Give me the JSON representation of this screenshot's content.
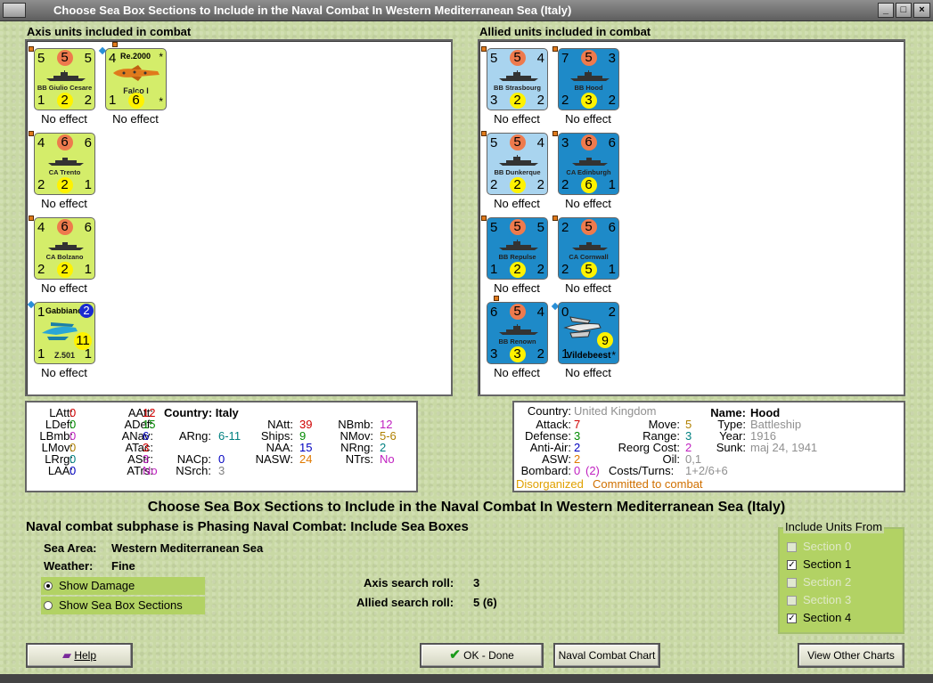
{
  "window": {
    "title": "Choose Sea Box Sections to Include in the Naval Combat In Western Mediterranean Sea (Italy)"
  },
  "axis_panel": {
    "title": "Axis units included in combat"
  },
  "allied_panel": {
    "title": "Allied units included in combat"
  },
  "axis_units": [
    {
      "name": "BB Giulio Cesare",
      "tl": "5",
      "top": "5",
      "tr": "5",
      "bl": "1",
      "bot": "2",
      "br": "2",
      "status": "No effect"
    },
    {
      "name": "Falco I",
      "type": "Re.2000",
      "tl": "4",
      "tr": "*",
      "bl": "1",
      "bot": "6",
      "br": "*",
      "status": "No effect"
    },
    {
      "name": "CA Trento",
      "tl": "4",
      "top": "6",
      "tr": "6",
      "bl": "2",
      "bot": "2",
      "br": "1",
      "status": "No effect"
    },
    {
      "name": "CA Bolzano",
      "tl": "4",
      "top": "6",
      "tr": "6",
      "bl": "2",
      "bot": "2",
      "br": "1",
      "status": "No effect"
    },
    {
      "name": "Z.501",
      "type": "Gabbiano",
      "tl": "1",
      "top": "2",
      "bl": "1",
      "bot": "11",
      "br": "1",
      "status": "No effect"
    }
  ],
  "allied_units": [
    {
      "name": "BB Strasbourg",
      "tl": "5",
      "top": "5",
      "tr": "4",
      "bl": "3",
      "bot": "2",
      "br": "2",
      "status": "No effect"
    },
    {
      "name": "BB Hood",
      "tl": "7",
      "top": "5",
      "tr": "3",
      "bl": "2",
      "bot": "3",
      "br": "2",
      "status": "No effect"
    },
    {
      "name": "BB Dunkerque",
      "tl": "5",
      "top": "5",
      "tr": "4",
      "bl": "2",
      "bot": "2",
      "br": "2",
      "status": "No effect"
    },
    {
      "name": "CA Edinburgh",
      "tl": "3",
      "top": "6",
      "tr": "6",
      "bl": "2",
      "bot": "6",
      "br": "1",
      "status": "No effect"
    },
    {
      "name": "BB Repulse",
      "tl": "5",
      "top": "5",
      "tr": "5",
      "bl": "1",
      "bot": "2",
      "br": "2",
      "status": "No effect"
    },
    {
      "name": "CA Cornwall",
      "tl": "2",
      "top": "5",
      "tr": "6",
      "bl": "2",
      "bot": "5",
      "br": "1",
      "status": "No effect"
    },
    {
      "name": "BB Renown",
      "tl": "6",
      "top": "5",
      "tr": "4",
      "bl": "3",
      "bot": "3",
      "br": "2",
      "status": "No effect"
    },
    {
      "name": "Vildebeest",
      "tl": "0",
      "tr": "2",
      "bl": "1",
      "bot": "9",
      "br": "*",
      "status": "No effect"
    }
  ],
  "axis_stats": {
    "latt_l": "LAtt:",
    "latt": "0",
    "ldef_l": "LDef:",
    "ldef": "0",
    "lbmb_l": "LBmb:",
    "lbmb": "0",
    "lmov_l": "LMov:",
    "lmov": "0",
    "lrrg_l": "LRrg:",
    "lrrg": "0",
    "laa_l": "LAA:",
    "laa": "0",
    "aatt_l": "AAtt:",
    "aatt": "12",
    "adef_l": "ADef:",
    "adef": "15",
    "anav_l": "ANav:",
    "anav": "6",
    "atac_l": "ATac:",
    "atac": "3",
    "astr_l": "AStr:",
    "astr": "3",
    "atrs_l": "ATrs:",
    "atrs": "No",
    "country": "Country: Italy",
    "arng_l": "ARng:",
    "arng": "6-11",
    "nacp_l": "NACp:",
    "nacp": "0",
    "nsrch_l": "NSrch:",
    "nsrch": "3",
    "natt_l": "NAtt:",
    "natt": "39",
    "ships_l": "Ships:",
    "ships": "9",
    "naa_l": "NAA:",
    "naa": "15",
    "nasw_l": "NASW:",
    "nasw": "24",
    "nbmb_l": "NBmb:",
    "nbmb": "12",
    "nmov_l": "NMov:",
    "nmov": "5-6",
    "nrng_l": "NRng:",
    "nrng": "2",
    "ntrs_l": "NTrs:",
    "ntrs": "No"
  },
  "unit_info": {
    "country_l": "Country:",
    "country": "United Kingdom",
    "attack_l": "Attack:",
    "attack": "7",
    "defense_l": "Defense:",
    "defense": "3",
    "antiair_l": "Anti-Air:",
    "antiair": "2",
    "asw_l": "ASW:",
    "asw": "2",
    "bombard_l": "Bombard:",
    "bombard": "0",
    "bombard2": "(2)",
    "move_l": "Move:",
    "move": "5",
    "range_l": "Range:",
    "range": "3",
    "reorg_l": "Reorg Cost:",
    "reorg": "2",
    "oil_l": "Oil:",
    "oil": "0,1",
    "costs_l": "Costs/Turns:",
    "costs": "1+2/6+6",
    "name_l": "Name:",
    "name": "Hood",
    "type_l": "Type:",
    "type": "Battleship",
    "year_l": "Year:",
    "year": "1916",
    "sunk_l": "Sunk:",
    "sunk": "maj 24, 1941",
    "disorganized": "Disorganized",
    "committed": "Committed to combat"
  },
  "main": {
    "heading": "Choose Sea Box Sections to Include in the Naval Combat In Western Mediterranean Sea (Italy)",
    "subphase": "Naval combat subphase is Phasing Naval Combat: Include Sea Boxes",
    "sea_area_l": "Sea Area:",
    "sea_area": "Western Mediterranean Sea",
    "weather_l": "Weather:",
    "weather": "Fine",
    "axis_roll_l": "Axis search roll:",
    "axis_roll": "3",
    "allied_roll_l": "Allied search roll:",
    "allied_roll": "5 (6)"
  },
  "view_options": {
    "show_damage": "Show Damage",
    "show_sections": "Show Sea Box Sections"
  },
  "include_units": {
    "legend": "Include Units From",
    "sections": [
      {
        "label": "Section 0",
        "checked": false,
        "enabled": false
      },
      {
        "label": "Section 1",
        "checked": true,
        "enabled": true
      },
      {
        "label": "Section 2",
        "checked": false,
        "enabled": false
      },
      {
        "label": "Section 3",
        "checked": false,
        "enabled": false
      },
      {
        "label": "Section 4",
        "checked": true,
        "enabled": true
      }
    ]
  },
  "buttons": {
    "help": "Help",
    "ok": "OK - Done",
    "naval_chart": "Naval Combat Chart",
    "other_charts": "View Other Charts"
  },
  "colors": {
    "axis_counter": "#d4ed6a",
    "allied_light": "#a9d4ef",
    "allied_dark": "#1e8ac8",
    "attack": "#ee7a4d",
    "defense": "#fff200",
    "bg": "#c9d9a5"
  }
}
